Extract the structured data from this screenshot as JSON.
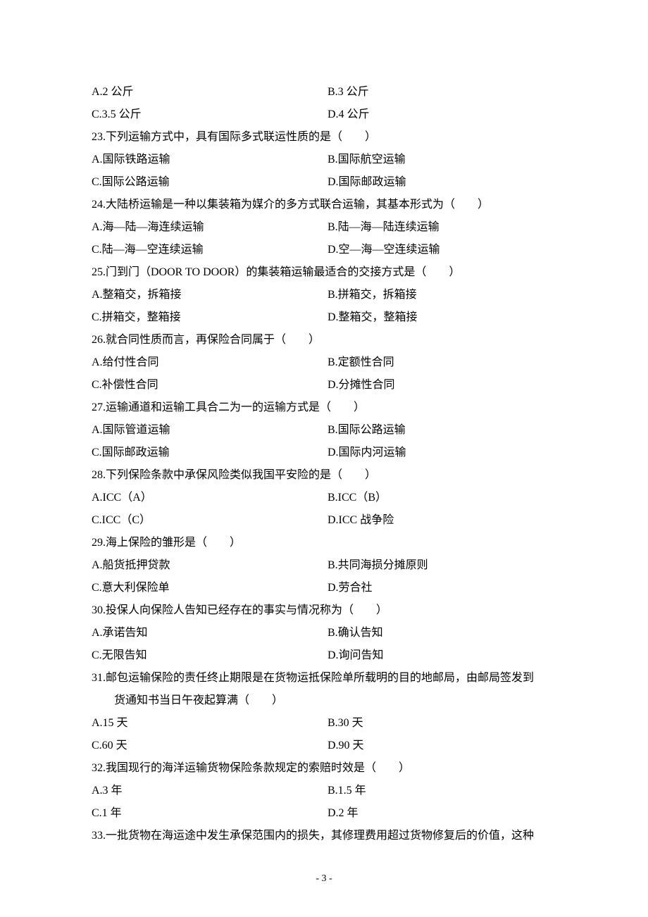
{
  "q22": {
    "a": "A.2 公斤",
    "b": "B.3 公斤",
    "c": "C.3.5 公斤",
    "d": "D.4 公斤"
  },
  "q23": {
    "text": "23.下列运输方式中，具有国际多式联运性质的是（　　）",
    "a": "A.国际铁路运输",
    "b": "B.国际航空运输",
    "c": "C.国际公路运输",
    "d": "D.国际邮政运输"
  },
  "q24": {
    "text": "24.大陆桥运输是一种以集装箱为媒介的多方式联合运输，其基本形式为（　　）",
    "a": "A.海—陆—海连续运输",
    "b": "B.陆—海—陆连续运输",
    "c": "C.陆—海—空连续运输",
    "d": "D.空—海—空连续运输"
  },
  "q25": {
    "text": "25.门到门（DOOR TO DOOR）的集装箱运输最适合的交接方式是（　　）",
    "a": "A.整箱交，拆箱接",
    "b": "B.拼箱交，拆箱接",
    "c": "C.拼箱交，整箱接",
    "d": "D.整箱交，整箱接"
  },
  "q26": {
    "text": "26.就合同性质而言，再保险合同属于（　　）",
    "a": "A.给付性合同",
    "b": "B.定额性合同",
    "c": "C.补偿性合同",
    "d": "D.分摊性合同"
  },
  "q27": {
    "text": "27.运输通道和运输工具合二为一的运输方式是（　　）",
    "a": "A.国际管道运输",
    "b": "B.国际公路运输",
    "c": "C.国际邮政运输",
    "d": "D.国际内河运输"
  },
  "q28": {
    "text": "28.下列保险条款中承保风险类似我国平安险的是（　　）",
    "a": "A.ICC（A）",
    "b": "B.ICC（B）",
    "c": "C.ICC（C）",
    "d": "D.ICC 战争险"
  },
  "q29": {
    "text": "29.海上保险的雏形是（　　）",
    "a": "A.船货抵押贷款",
    "b": "B.共同海损分摊原则",
    "c": "C.意大利保险单",
    "d": "D.劳合社"
  },
  "q30": {
    "text": "30.投保人向保险人告知已经存在的事实与情况称为（　　）",
    "a": "A.承诺告知",
    "b": "B.确认告知",
    "c": "C.无限告知",
    "d": "D.询问告知"
  },
  "q31": {
    "text1": "31.邮包运输保险的责任终止期限是在货物运抵保险单所载明的目的地邮局，由邮局签发到",
    "text2": "货通知书当日午夜起算满（　　）",
    "a": "A.15 天",
    "b": "B.30 天",
    "c": "C.60 天",
    "d": "D.90 天"
  },
  "q32": {
    "text": "32.我国现行的海洋运输货物保险条款规定的索赔时效是（　　）",
    "a": "A.3 年",
    "b": "B.1.5 年",
    "c": "C.1 年",
    "d": "D.2 年"
  },
  "q33": {
    "text": "33.一批货物在海运途中发生承保范围内的损失，其修理费用超过货物修复后的价值，这种"
  },
  "pageNumber": "- 3 -"
}
